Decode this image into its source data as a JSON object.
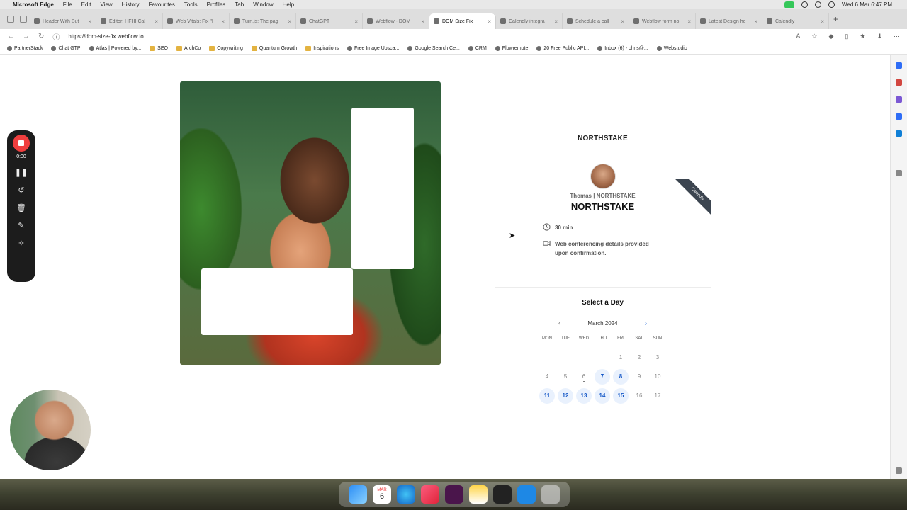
{
  "menubar": {
    "app": "Microsoft Edge",
    "items": [
      "File",
      "Edit",
      "View",
      "History",
      "Favourites",
      "Tools",
      "Profiles",
      "Tab",
      "Window",
      "Help"
    ],
    "clock": "Wed 6 Mar 6:47 PM"
  },
  "tabs": [
    {
      "label": "Header With But"
    },
    {
      "label": "Editor: HFHI Cal"
    },
    {
      "label": "Web Vitals: Fix \"I"
    },
    {
      "label": "Turn.js: The pag"
    },
    {
      "label": "ChatGPT"
    },
    {
      "label": "Webflow - DOM"
    },
    {
      "label": "DOM Size Fix",
      "active": true
    },
    {
      "label": "Calendly integra"
    },
    {
      "label": "Schedule a call"
    },
    {
      "label": "Webflow form no"
    },
    {
      "label": "Latest Design he"
    },
    {
      "label": "Calendly"
    }
  ],
  "address": {
    "url": "https://dom-size-fix.webflow.io"
  },
  "bookmarks": [
    {
      "label": "PartnerStack"
    },
    {
      "label": "Chat GTP"
    },
    {
      "label": "Atlas | Powered by..."
    },
    {
      "label": "SEO"
    },
    {
      "label": "ArchCo"
    },
    {
      "label": "Copywriting"
    },
    {
      "label": "Quantum Growth"
    },
    {
      "label": "Inspirations"
    },
    {
      "label": "Free Image Upsca..."
    },
    {
      "label": "Google Search Ce..."
    },
    {
      "label": "CRM"
    },
    {
      "label": "Flowremote"
    },
    {
      "label": "20 Free Public API..."
    },
    {
      "label": "Inbox (6) - chris@..."
    },
    {
      "label": "Webstudio"
    }
  ],
  "recorder": {
    "time": "0:00"
  },
  "calendly": {
    "company": "NORTHSTAKE",
    "host": "Thomas | NORTHSTAKE",
    "event_title": "NORTHSTAKE",
    "duration": "30 min",
    "location": "Web conferencing details provided upon confirmation.",
    "select_title": "Select a Day",
    "month": "March 2024",
    "badge": "Calendly",
    "weekdays": [
      "MON",
      "TUE",
      "WED",
      "THU",
      "FRI",
      "SAT",
      "SUN"
    ],
    "weeks": [
      [
        null,
        null,
        null,
        null,
        {
          "d": "1"
        },
        {
          "d": "2"
        },
        {
          "d": "3"
        }
      ],
      [
        {
          "d": "4"
        },
        {
          "d": "5"
        },
        {
          "d": "6",
          "today": true
        },
        {
          "d": "7",
          "avail": true
        },
        {
          "d": "8",
          "avail": true
        },
        {
          "d": "9"
        },
        {
          "d": "10"
        }
      ],
      [
        {
          "d": "11",
          "avail": true
        },
        {
          "d": "12",
          "avail": true
        },
        {
          "d": "13",
          "avail": true
        },
        {
          "d": "14",
          "avail": true
        },
        {
          "d": "15",
          "avail": true
        },
        {
          "d": "16"
        },
        {
          "d": "17"
        }
      ]
    ]
  },
  "dock": {
    "calendar_month": "MAR",
    "calendar_day": "6"
  },
  "colors": {
    "accent_blue": "#1759c7",
    "available_bg": "#e9f1fd",
    "record_red": "#f03e3e"
  }
}
